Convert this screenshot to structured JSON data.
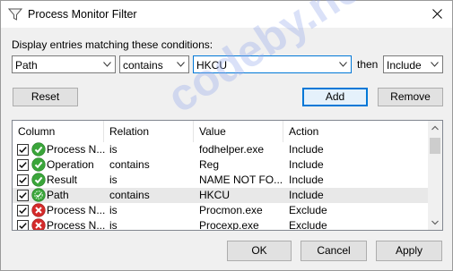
{
  "window": {
    "title": "Process Monitor Filter"
  },
  "conditions": {
    "label": "Display entries matching these conditions:",
    "column_value": "Path",
    "relation_value": "contains",
    "value_text": "HKCU",
    "then_label": "then",
    "action_value": "Include"
  },
  "buttons": {
    "reset": "Reset",
    "add": "Add",
    "remove": "Remove",
    "ok": "OK",
    "cancel": "Cancel",
    "apply": "Apply"
  },
  "list": {
    "headers": [
      "Column",
      "Relation",
      "Value",
      "Action"
    ],
    "rows": [
      {
        "column": "Process N...",
        "relation": "is",
        "value": "fodhelper.exe",
        "action": "Include",
        "status": "include"
      },
      {
        "column": "Operation",
        "relation": "contains",
        "value": "Reg",
        "action": "Include",
        "status": "include"
      },
      {
        "column": "Result",
        "relation": "is",
        "value": "NAME NOT FO...",
        "action": "Include",
        "status": "include"
      },
      {
        "column": "Path",
        "relation": "contains",
        "value": "HKCU",
        "action": "Include",
        "status": "include-new"
      },
      {
        "column": "Process N...",
        "relation": "is",
        "value": "Procmon.exe",
        "action": "Exclude",
        "status": "exclude"
      },
      {
        "column": "Process N...",
        "relation": "is",
        "value": "Procexp.exe",
        "action": "Exclude",
        "status": "exclude"
      }
    ]
  },
  "watermark": "codeby.net",
  "colors": {
    "include": "#3aa53a",
    "exclude": "#d42a2a",
    "accent": "#0078d7"
  }
}
